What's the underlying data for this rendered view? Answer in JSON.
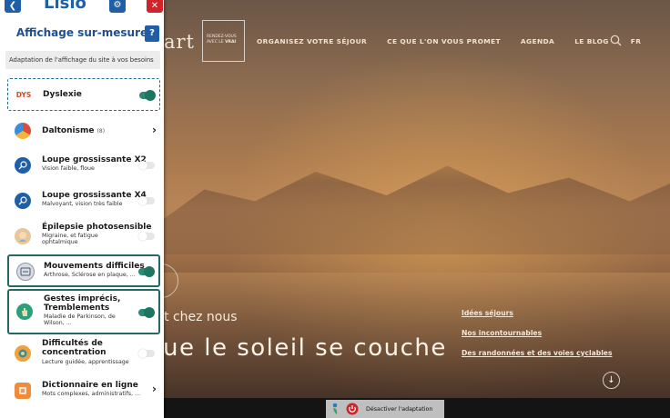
{
  "panel": {
    "brand": "Lisio",
    "title": "Affichage sur-mesure",
    "help_label": "?",
    "subtitle": "Adaptation de l'affichage du site à vos besoins",
    "items": [
      {
        "icon_text": "DYS",
        "title": "Dyslexie",
        "subtitle": "",
        "control": "toggle",
        "state": "on"
      },
      {
        "title": "Daltonisme",
        "count": "(8)",
        "subtitle": "",
        "control": "chevron"
      },
      {
        "title": "Loupe grossissante X2",
        "subtitle": "Vision faible, floue",
        "control": "toggle",
        "state": "off"
      },
      {
        "title": "Loupe grossissante X4",
        "subtitle": "Malvoyant, vision très faible",
        "control": "toggle",
        "state": "off"
      },
      {
        "title": "Épilepsie photosensible",
        "subtitle": "Migraine, et fatigue ophtalmique",
        "control": "toggle",
        "state": "off"
      },
      {
        "title": "Mouvements difficiles",
        "subtitle": "Arthrose, Sclérose en plaque, ...",
        "control": "toggle",
        "state": "on"
      },
      {
        "title": "Gestes imprécis, Tremblements",
        "subtitle": "Maladie de Parkinson, de Wilson, ...",
        "control": "toggle",
        "state": "on"
      },
      {
        "title": "Difficultés de concentration",
        "subtitle": "Lecture guidée, apprentissage",
        "control": "toggle",
        "state": "off"
      },
      {
        "title": "Dictionnaire en ligne",
        "subtitle": "Mots complexes, administratifs, ...",
        "control": "chevron"
      }
    ]
  },
  "site": {
    "logo_fragment": "art",
    "tagline_line1": "RENDEZ-VOUS",
    "tagline_line2_pre": "AVEC LE ",
    "tagline_line2_bold": "VRAI",
    "nav": [
      "ORGANISEZ VOTRE SÉJOUR",
      "CE QUE L'ON VOUS PROMET",
      "AGENDA",
      "LE BLOG",
      "FR"
    ],
    "hero_sub": "t chez nous",
    "hero_title": "ue le soleil se couche",
    "links": [
      "Idées séjours",
      "Nos incontournables",
      "Des randonnées et des voies cyclables"
    ],
    "deactivate_label": "Désactiver l'adaptation"
  },
  "colors": {
    "brand_blue": "#1f5fa8",
    "toggle_on": "#2a8a73",
    "close_red": "#d0232a"
  }
}
